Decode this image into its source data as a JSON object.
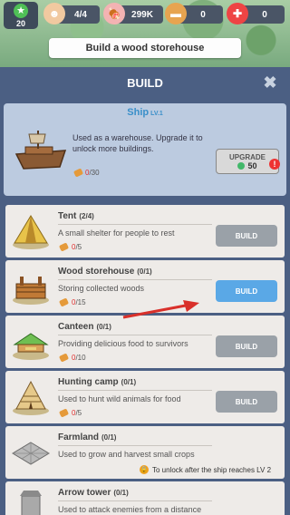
{
  "hud": {
    "level": "20",
    "people": "4/4",
    "food": "299K",
    "wood": "0",
    "gems": "0"
  },
  "task": "Build a wood storehouse",
  "panel": {
    "title": "BUILD",
    "close_icon": "close-icon"
  },
  "ship": {
    "name": "Ship",
    "level": "LV.1",
    "description": "Used as a warehouse. Upgrade it to unlock more buildings.",
    "cost_have": "0",
    "cost_need": "/30",
    "upgrade_label": "UPGRADE",
    "upgrade_cost": "50",
    "alert": "!"
  },
  "buildings": [
    {
      "name": "Tent",
      "count": "(2/4)",
      "description": "A small shelter for people to rest",
      "cost_have": "0",
      "cost_need": "/5",
      "button": "BUILD",
      "icon": "tent-icon"
    },
    {
      "name": "Wood storehouse",
      "count": "(0/1)",
      "description": "Storing collected woods",
      "cost_have": "0",
      "cost_need": "/15",
      "button": "BUILD",
      "icon": "wood-storehouse-icon"
    },
    {
      "name": "Canteen",
      "count": "(0/1)",
      "description": "Providing delicious food to survivors",
      "cost_have": "0",
      "cost_need": "/10",
      "button": "BUILD",
      "icon": "canteen-icon"
    },
    {
      "name": "Hunting camp",
      "count": "(0/1)",
      "description": "Used to hunt wild animals for food",
      "cost_have": "0",
      "cost_need": "/5",
      "button": "BUILD",
      "icon": "hunting-camp-icon"
    },
    {
      "name": "Farmland",
      "count": "(0/1)",
      "description": "Used to grow and harvest small crops",
      "locked_note": "To unlock after the ship reaches LV 2",
      "icon": "farmland-icon"
    },
    {
      "name": "Arrow tower",
      "count": "(0/1)",
      "description": "Used to attack enemies from a distance",
      "icon": "arrow-tower-icon"
    }
  ],
  "colors": {
    "panel": "#4b5f83",
    "build_active": "#5aa8e6",
    "build_default": "#9aa1a8",
    "cost_insufficient": "#e03030"
  }
}
